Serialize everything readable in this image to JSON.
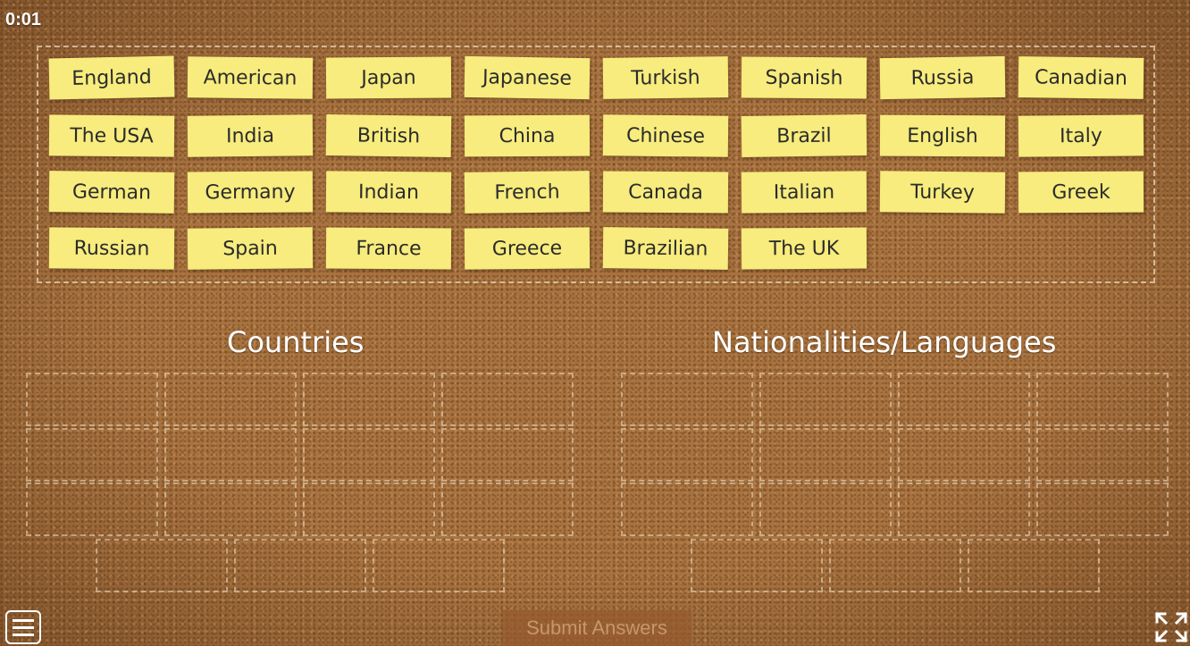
{
  "timer": "0:01",
  "cards": [
    {
      "label": "England"
    },
    {
      "label": "American"
    },
    {
      "label": "Japan"
    },
    {
      "label": "Japanese"
    },
    {
      "label": "Turkish"
    },
    {
      "label": "Spanish"
    },
    {
      "label": "Russia"
    },
    {
      "label": "Canadian"
    },
    {
      "label": "The USA"
    },
    {
      "label": "India"
    },
    {
      "label": "British"
    },
    {
      "label": "China"
    },
    {
      "label": "Chinese"
    },
    {
      "label": "Brazil"
    },
    {
      "label": "English"
    },
    {
      "label": "Italy"
    },
    {
      "label": "German"
    },
    {
      "label": "Germany"
    },
    {
      "label": "Indian"
    },
    {
      "label": "French"
    },
    {
      "label": "Canada"
    },
    {
      "label": "Italian"
    },
    {
      "label": "Turkey"
    },
    {
      "label": "Greek"
    },
    {
      "label": "Russian"
    },
    {
      "label": "Spain"
    },
    {
      "label": "France"
    },
    {
      "label": "Greece"
    },
    {
      "label": "Brazilian"
    },
    {
      "label": "The UK"
    }
  ],
  "groups": {
    "countries": {
      "title": "Countries"
    },
    "nationalities": {
      "title": "Nationalities/Languages"
    }
  },
  "submit_label": "Submit Answers",
  "icons": {
    "menu": "hamburger-menu-icon",
    "fullscreen": "expand-fullscreen-icon"
  },
  "colors": {
    "card": "#f7ec7d",
    "board": "#a9733f",
    "text_on_board": "#ffffff"
  }
}
